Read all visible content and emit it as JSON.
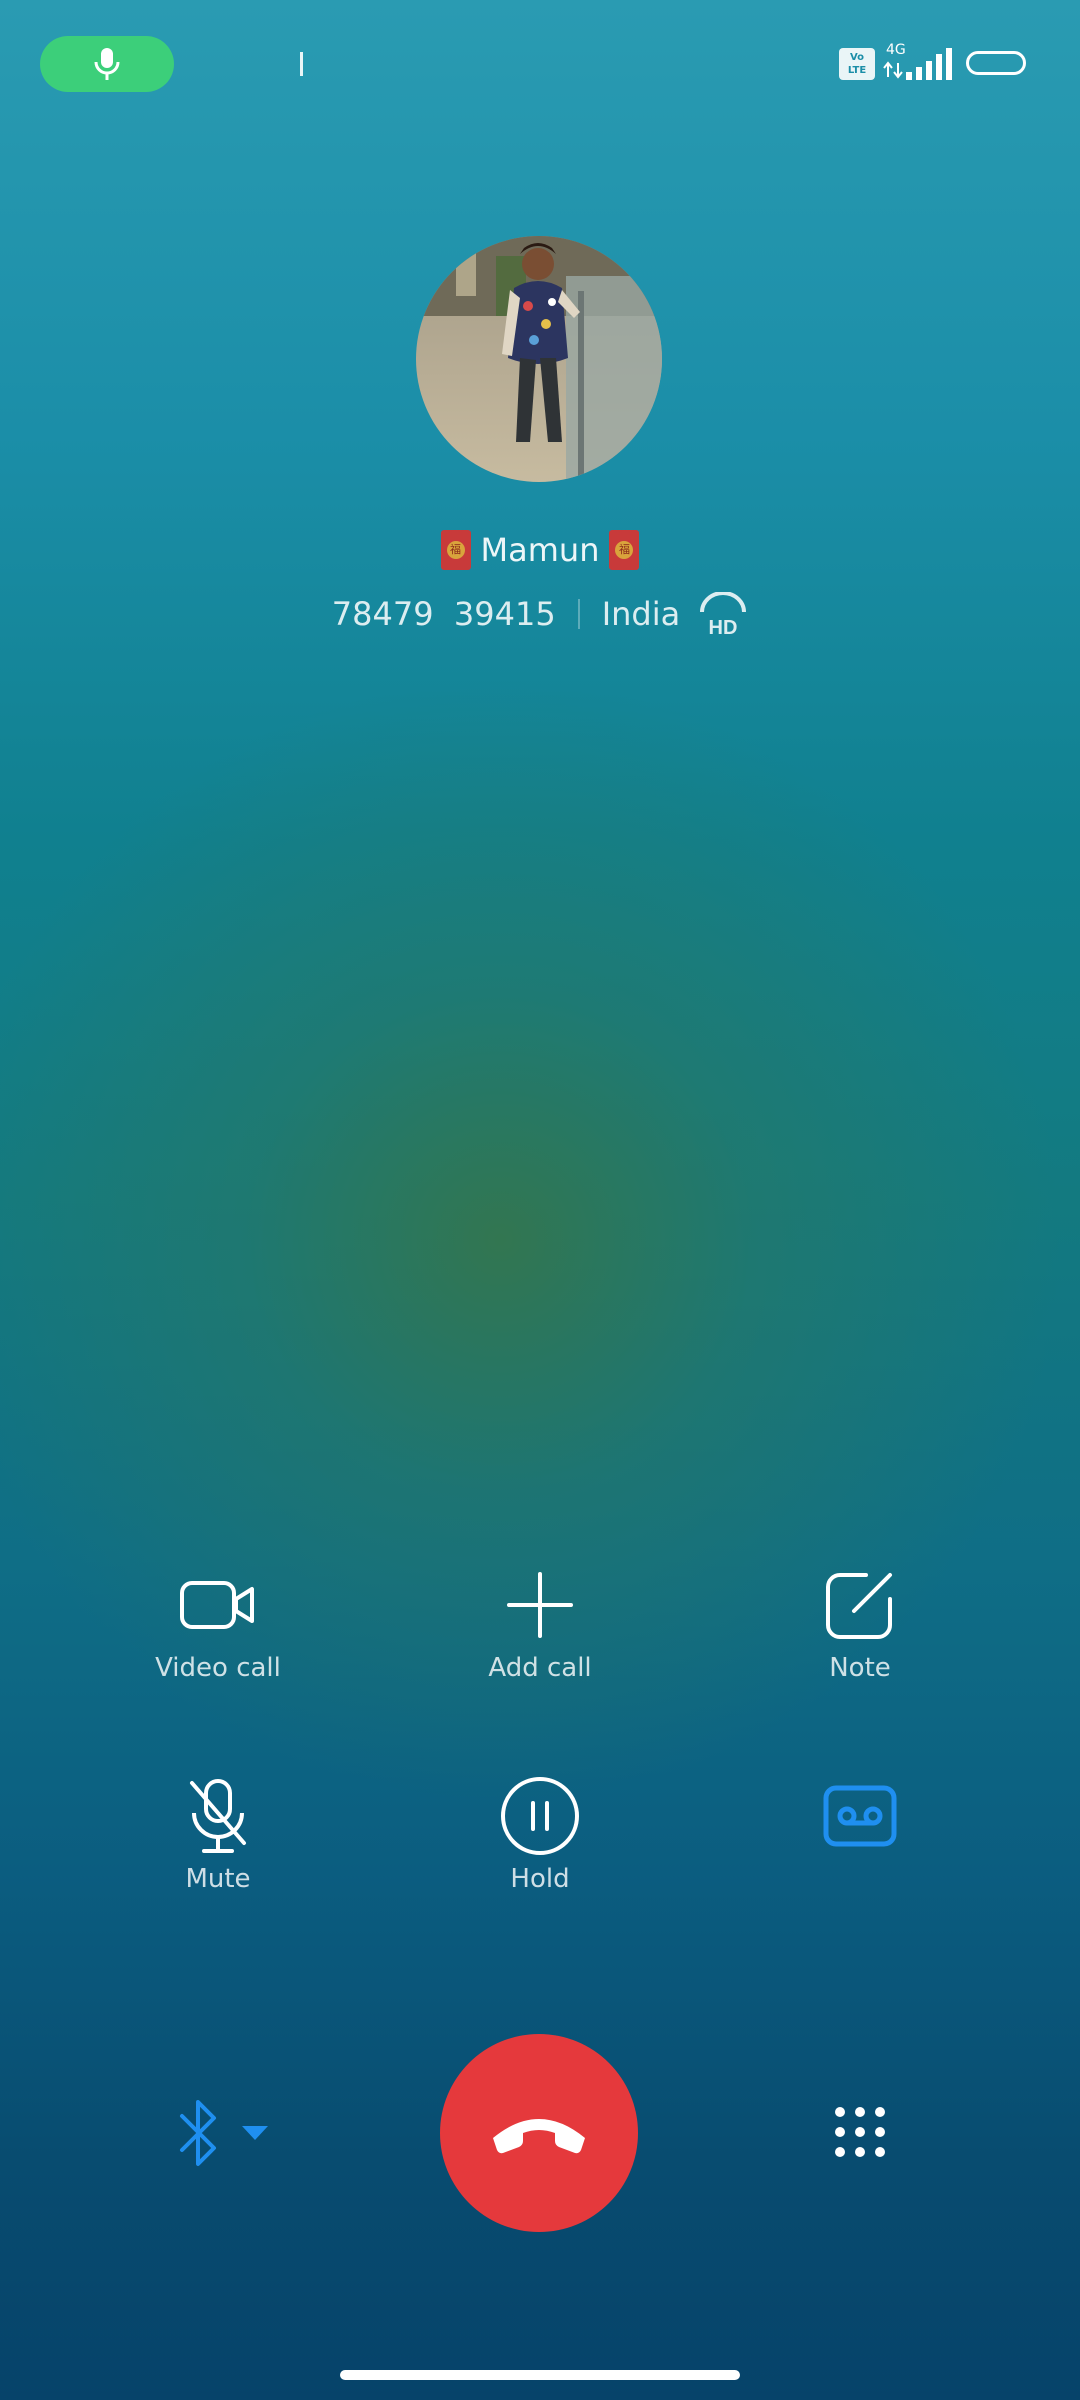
{
  "status_bar": {
    "mic_indicator_icon": "microphone-icon",
    "volte_label_top": "Vo",
    "volte_label_bottom": "LTE",
    "network_type": "4G",
    "signal_icon": "signal-bars-icon",
    "battery_icon": "battery-icon"
  },
  "caller": {
    "name": "Mamun",
    "number": "78479  39415",
    "location": "India",
    "hd_label": "HD",
    "flag_emblem": "福"
  },
  "actions": {
    "video_call": "Video call",
    "add_call": "Add call",
    "note": "Note",
    "mute": "Mute",
    "hold": "Hold",
    "record_icon": "voicemail-record-icon"
  },
  "bottom": {
    "bluetooth_icon": "bluetooth-icon",
    "end_call_icon": "end-call-icon",
    "keypad_icon": "keypad-icon"
  },
  "colors": {
    "end_call": "#e5393c",
    "mic_pill": "#3ccf7a",
    "accent_blue": "#1f8ff0"
  }
}
